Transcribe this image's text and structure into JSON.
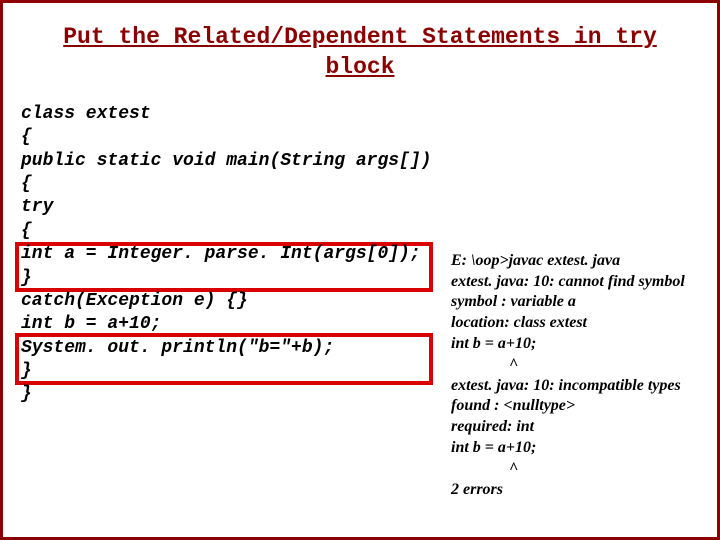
{
  "title": "Put the Related/Dependent Statements in try block",
  "code": {
    "l1": "class extest",
    "l2": "{",
    "l3": "public static void main(String args[])",
    "l4": "{",
    "l5": "try",
    "l6": "{",
    "l7": "int a = Integer. parse. Int(args[0]);",
    "l8": "}",
    "l9": "catch(Exception e) {}",
    "l10": "int b = a+10;",
    "l11": "System. out. println(\"b=\"+b);",
    "l12": "}",
    "l13": "}"
  },
  "error": {
    "l1": "E: \\oop>javac extest. java",
    "l2": "extest. java: 10: cannot find symbol",
    "l3": "symbol  : variable a",
    "l4": "location: class extest",
    "l5": "int b = a+10;",
    "l6": "^",
    "l7": "extest. java: 10: incompatible types",
    "l8": "found   : <nulltype>",
    "l9": "required: int",
    "l10": "int b = a+10;",
    "l11": "^",
    "l12": "2 errors"
  }
}
